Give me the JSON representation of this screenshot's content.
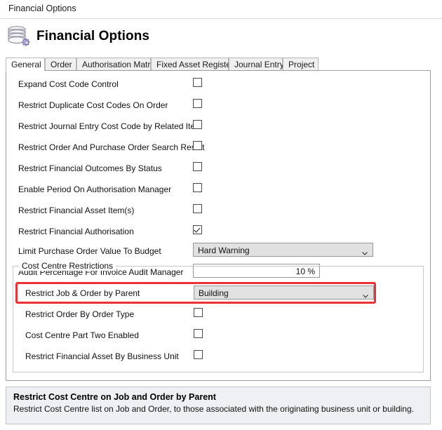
{
  "window": {
    "title": "Financial Options"
  },
  "header": {
    "title": "Financial Options",
    "icon": "database-gear-icon"
  },
  "tabs": [
    {
      "label": "General",
      "active": true
    },
    {
      "label": "Order",
      "active": false
    },
    {
      "label": "Authorisation Matrix",
      "active": false
    },
    {
      "label": "Fixed Asset Register",
      "active": false
    },
    {
      "label": "Journal Entry",
      "active": false
    },
    {
      "label": "Project",
      "active": false
    }
  ],
  "general_options": [
    {
      "label": "Expand Cost Code Control",
      "type": "checkbox",
      "checked": false
    },
    {
      "label": "Restrict Duplicate Cost Codes On Order",
      "type": "checkbox",
      "checked": false
    },
    {
      "label": "Restrict Journal Entry Cost Code by Related Item",
      "type": "checkbox",
      "checked": false
    },
    {
      "label": "Restrict Order And Purchase Order Search Result",
      "type": "checkbox",
      "checked": false
    },
    {
      "label": "Restrict Financial Outcomes By Status",
      "type": "checkbox",
      "checked": false
    },
    {
      "label": "Enable Period On Authorisation Manager",
      "type": "checkbox",
      "checked": false
    },
    {
      "label": "Restrict Financial Asset Item(s)",
      "type": "checkbox",
      "checked": false
    },
    {
      "label": "Restrict Financial Authorisation",
      "type": "checkbox",
      "checked": true
    },
    {
      "label": "Limit Purchase Order Value To Budget",
      "type": "combo",
      "value": "Hard Warning"
    },
    {
      "label": "Audit Percentage For Invoice Audit Manager",
      "type": "text",
      "value": "10 %"
    }
  ],
  "cost_centre_group": {
    "title": "Cost Centre Restrictions",
    "rows": [
      {
        "label": "Restrict Job & Order by Parent",
        "type": "combo",
        "value": "Building",
        "highlighted": true
      },
      {
        "label": "Restrict Order By Order Type",
        "type": "checkbox",
        "checked": false
      },
      {
        "label": "Cost Centre Part Two Enabled",
        "type": "checkbox",
        "checked": false
      },
      {
        "label": "Restrict Financial Asset By Business Unit",
        "type": "checkbox",
        "checked": false
      }
    ]
  },
  "info_panel": {
    "title": "Restrict Cost Centre on Job and Order by Parent",
    "body": "Restrict Cost Centre list on Job and Order, to those associated with the originating business unit or building."
  },
  "colors": {
    "highlight": "#ec3237",
    "panel_border": "#9d9d9d",
    "info_background": "#eef0f3"
  }
}
